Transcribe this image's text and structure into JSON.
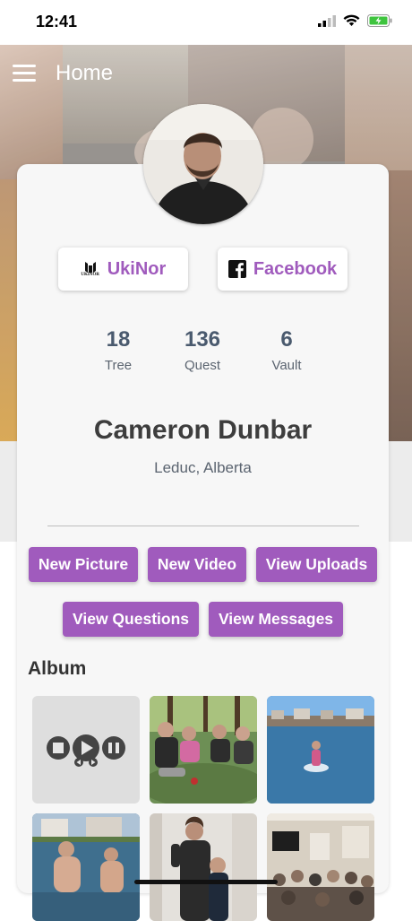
{
  "status_bar": {
    "time": "12:41",
    "icons": [
      "signal-icon",
      "wifi-icon",
      "battery-charging-icon"
    ],
    "battery_color": "#3ec43e"
  },
  "header": {
    "title": "Home",
    "menu_icon": "hamburger-menu-icon"
  },
  "profile": {
    "name": "Cameron Dunbar",
    "location": "Leduc, Alberta",
    "avatar_icon": "profile-photo"
  },
  "social_buttons": [
    {
      "label": "UkiNor",
      "icon": "ukinor-logo-icon",
      "logo_text": "UKINOR"
    },
    {
      "label": "Facebook",
      "icon": "facebook-icon"
    }
  ],
  "stats": [
    {
      "value": "18",
      "label": "Tree"
    },
    {
      "value": "136",
      "label": "Quest"
    },
    {
      "value": "6",
      "label": "Vault"
    }
  ],
  "actions": [
    {
      "label": "New Picture"
    },
    {
      "label": "New Video"
    },
    {
      "label": "View Uploads"
    },
    {
      "label": "View Questions"
    },
    {
      "label": "View Messages"
    }
  ],
  "album": {
    "title": "Album",
    "items": [
      {
        "kind": "video",
        "icon": "video-placeholder-icon"
      },
      {
        "kind": "photo",
        "icon": "photo-group-outdoors"
      },
      {
        "kind": "photo",
        "icon": "photo-paddleboard-lake"
      },
      {
        "kind": "photo",
        "icon": "photo-swimmers-lake"
      },
      {
        "kind": "photo",
        "icon": "photo-family-hallway"
      },
      {
        "kind": "photo",
        "icon": "photo-audience-room"
      }
    ]
  },
  "colors": {
    "accent": "#a05bbd",
    "card_background": "#f7f7f7",
    "stat_text": "#4a5a6e"
  }
}
